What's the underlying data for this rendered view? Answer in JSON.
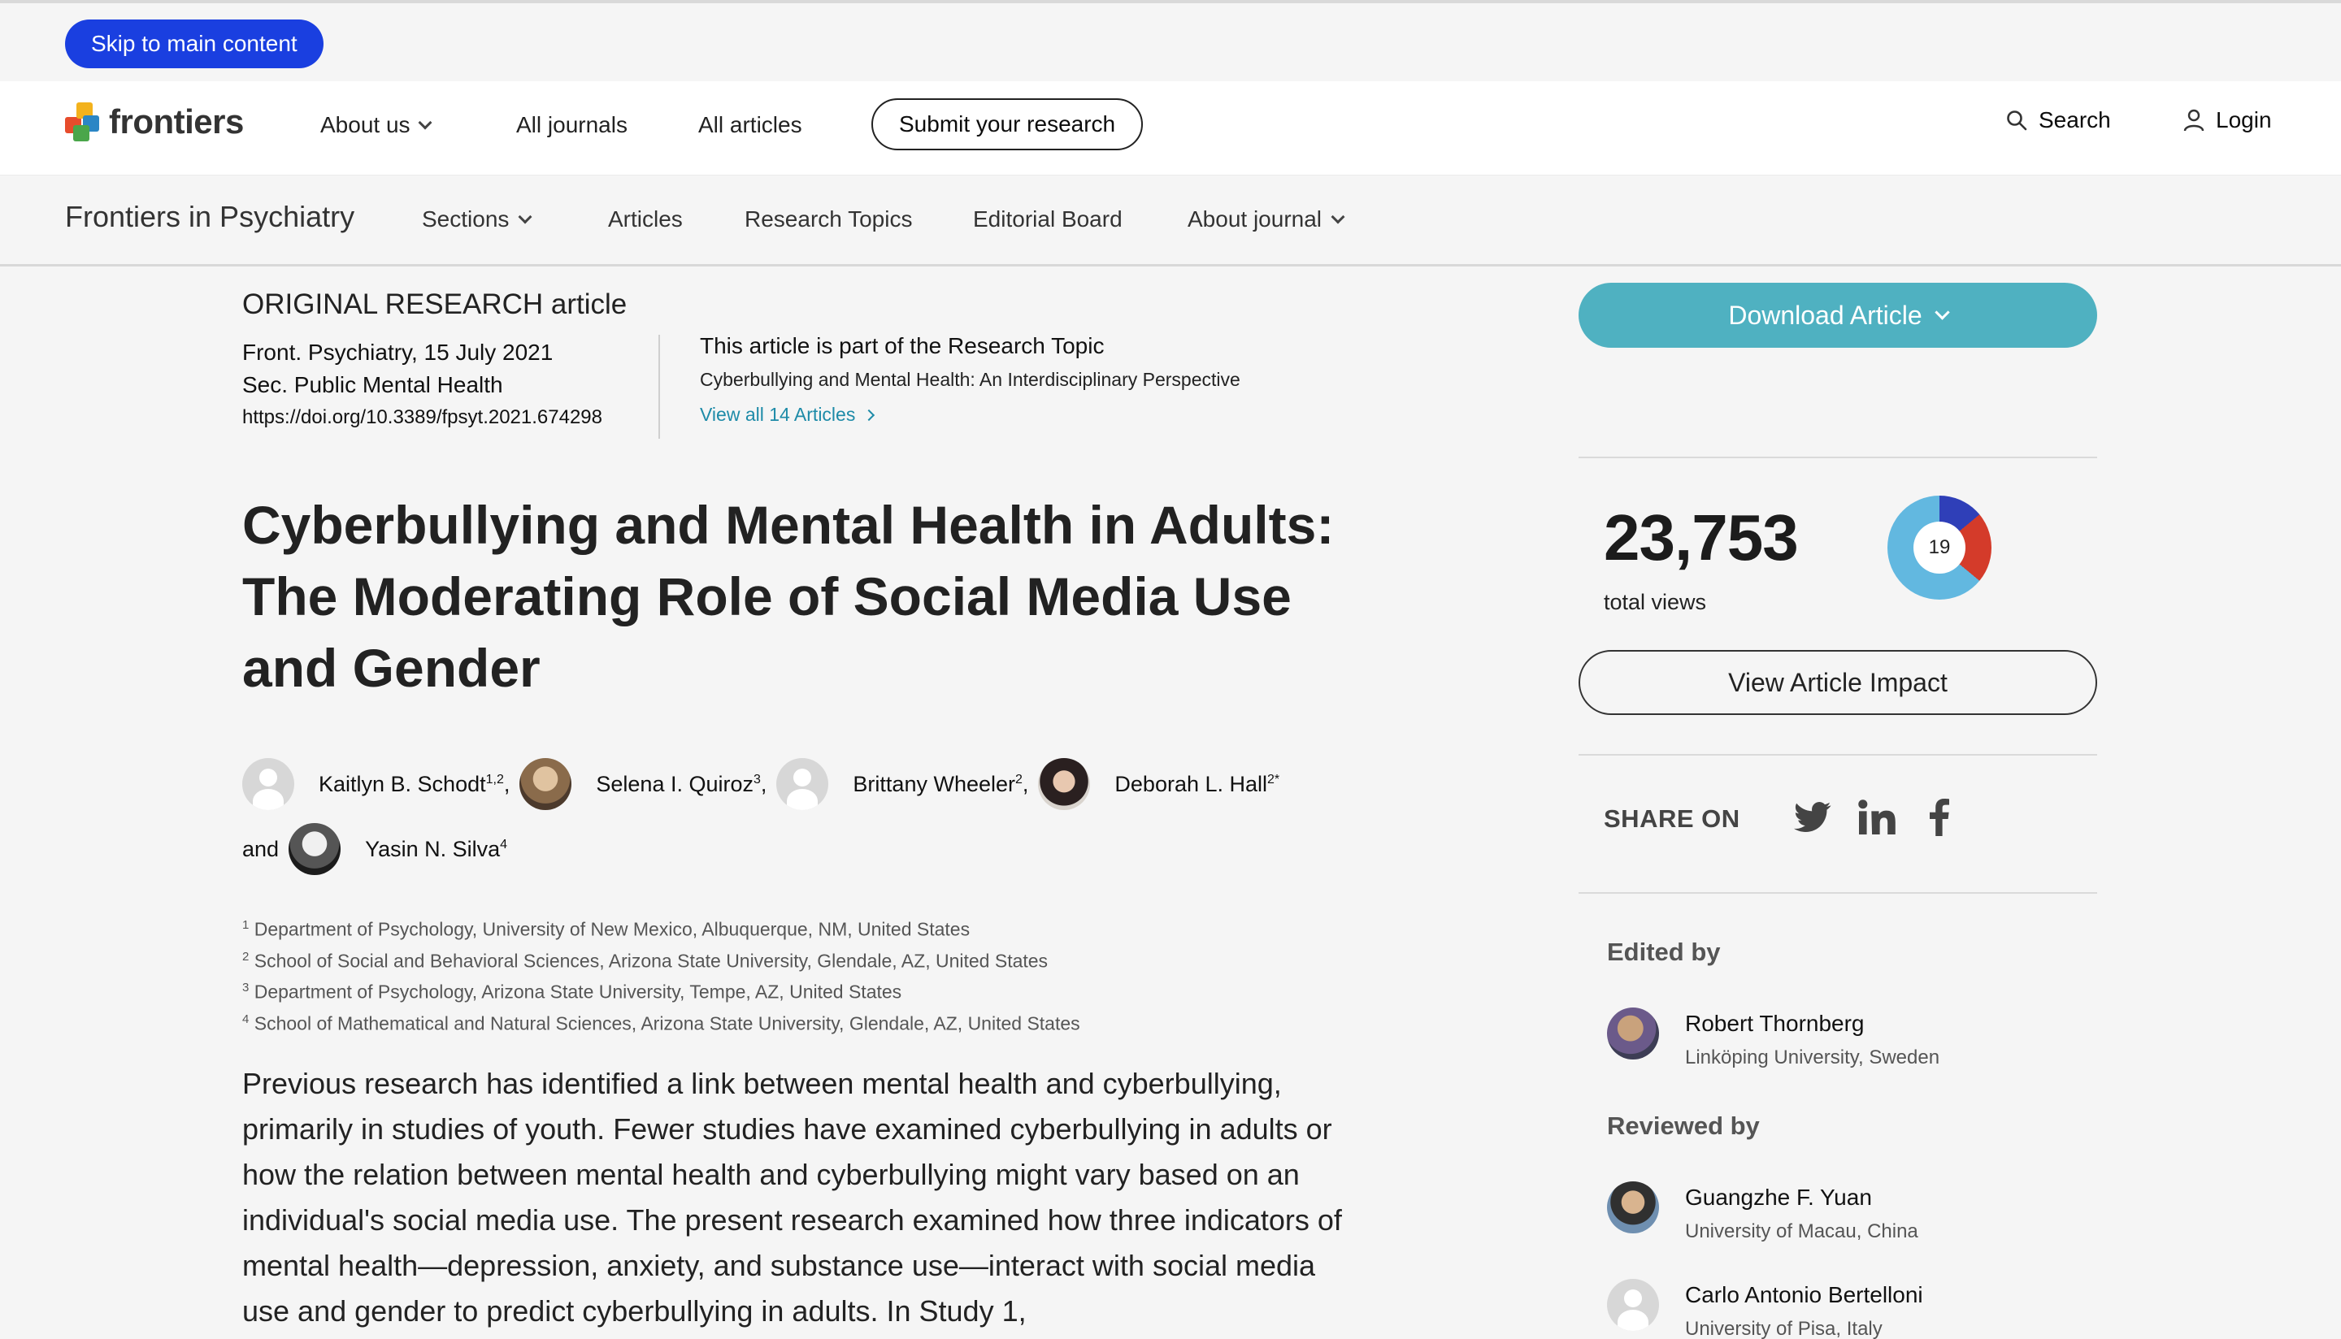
{
  "skip_link": "Skip to main content",
  "header": {
    "logo_text": "frontiers",
    "nav": {
      "about": "About us",
      "journals": "All journals",
      "articles": "All articles"
    },
    "submit": "Submit your research",
    "search": "Search",
    "login": "Login"
  },
  "journal_bar": {
    "title": "Frontiers in Psychiatry",
    "sections": "Sections",
    "articles": "Articles",
    "research_topics": "Research Topics",
    "editorial_board": "Editorial Board",
    "about_journal": "About journal"
  },
  "article": {
    "type": "ORIGINAL RESEARCH article",
    "journal_date": "Front. Psychiatry, 15 July 2021",
    "section": "Sec. Public Mental Health",
    "doi": "https://doi.org/10.3389/fpsyt.2021.674298",
    "topic_heading": "This article is part of the Research Topic",
    "topic_name": "Cyberbullying and Mental Health: An Interdisciplinary Perspective",
    "topic_link": "View all 14 Articles",
    "title": "Cyberbullying and Mental Health in Adults: The Moderating Role of Social Media Use and Gender",
    "authors": [
      {
        "name": "Kaitlyn B. Schodt",
        "sup": "1,2",
        "sep": ","
      },
      {
        "name": "Selena I. Quiroz",
        "sup": "3",
        "sep": ","
      },
      {
        "name": "Brittany Wheeler",
        "sup": "2",
        "sep": ","
      },
      {
        "name": "Deborah L. Hall",
        "sup": "2*",
        "sep": ""
      },
      {
        "name": "Yasin N. Silva",
        "sup": "4",
        "sep": ""
      }
    ],
    "and_word": "and",
    "affiliations": [
      {
        "num": "1",
        "text": "Department of Psychology, University of New Mexico, Albuquerque, NM, United States"
      },
      {
        "num": "2",
        "text": "School of Social and Behavioral Sciences, Arizona State University, Glendale, AZ, United States"
      },
      {
        "num": "3",
        "text": "Department of Psychology, Arizona State University, Tempe, AZ, United States"
      },
      {
        "num": "4",
        "text": "School of Mathematical and Natural Sciences, Arizona State University, Glendale, AZ, United States"
      }
    ],
    "abstract": "Previous research has identified a link between mental health and cyberbullying, primarily in studies of youth. Fewer studies have examined cyberbullying in adults or how the relation between mental health and cyberbullying might vary based on an individual's social media use. The present research examined how three indicators of mental health—depression, anxiety, and substance use—interact with social media use and gender to predict cyberbullying in adults. In Study 1,"
  },
  "sidebar": {
    "download": "Download Article",
    "views": "23,753",
    "views_label": "total views",
    "altmetric_score": "19",
    "impact": "View Article Impact",
    "share_label": "SHARE ON",
    "edited_by": "Edited by",
    "editor": {
      "name": "Robert Thornberg",
      "affiliation": "Linköping University, Sweden"
    },
    "reviewed_by": "Reviewed by",
    "reviewers": [
      {
        "name": "Guangzhe F. Yuan",
        "affiliation": "University of Macau, China"
      },
      {
        "name": "Carlo Antonio Bertelloni",
        "affiliation": "University of Pisa, Italy"
      }
    ]
  },
  "colors": {
    "skip_button": "#1a3fe0",
    "download_button": "#4fb1c1",
    "link": "#1e8ba8"
  }
}
